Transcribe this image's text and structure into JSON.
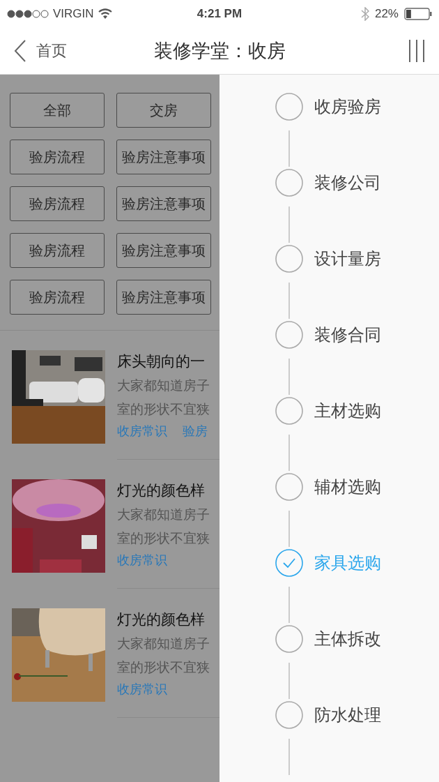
{
  "status_bar": {
    "carrier": "VIRGIN",
    "time": "4:21 PM",
    "battery": "22%"
  },
  "nav": {
    "back": "首页",
    "title": "装修学堂：收房"
  },
  "filters": [
    {
      "label": "全部"
    },
    {
      "label": "交房"
    },
    {
      "label": "验房流程"
    },
    {
      "label": "验房注意事项"
    },
    {
      "label": "验房流程"
    },
    {
      "label": "验房注意事项"
    },
    {
      "label": "验房流程"
    },
    {
      "label": "验房注意事项"
    },
    {
      "label": "验房流程"
    },
    {
      "label": "验房注意事项"
    }
  ],
  "articles": [
    {
      "title": "床头朝向的一",
      "lines": [
        "大家都知道房子",
        "室的形状不宜狭"
      ],
      "tags": [
        "收房常识",
        "验房"
      ]
    },
    {
      "title": "灯光的颜色样",
      "lines": [
        "大家都知道房子",
        "室的形状不宜狭"
      ],
      "tags": [
        "收房常识"
      ]
    },
    {
      "title": "灯光的颜色样",
      "lines": [
        "大家都知道房子",
        "室的形状不宜狭"
      ],
      "tags": [
        "收房常识"
      ]
    }
  ],
  "steps": [
    {
      "label": "收房验房",
      "selected": false
    },
    {
      "label": "装修公司",
      "selected": false
    },
    {
      "label": "设计量房",
      "selected": false
    },
    {
      "label": "装修合同",
      "selected": false
    },
    {
      "label": "主材选购",
      "selected": false
    },
    {
      "label": "辅材选购",
      "selected": false
    },
    {
      "label": "家具选购",
      "selected": true
    },
    {
      "label": "主体拆改",
      "selected": false
    },
    {
      "label": "防水处理",
      "selected": false
    }
  ]
}
